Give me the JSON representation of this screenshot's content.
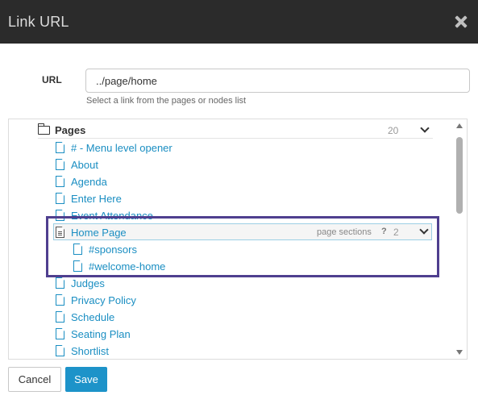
{
  "dialog": {
    "title": "Link URL"
  },
  "url_field": {
    "label": "URL",
    "value": "../page/home",
    "help": "Select a link from the pages or nodes list"
  },
  "tree": {
    "root": {
      "label": "Pages",
      "count": "20"
    },
    "items": [
      {
        "label": "# - Menu level opener"
      },
      {
        "label": "About"
      },
      {
        "label": "Agenda"
      },
      {
        "label": "Enter Here"
      },
      {
        "label": "Event Attendance"
      }
    ],
    "expanded": {
      "label": "Home Page",
      "sections_label": "page sections",
      "sections_help": "?",
      "sections_count": "2",
      "sections": [
        {
          "label": "#sponsors"
        },
        {
          "label": "#welcome-home"
        }
      ]
    },
    "items_after": [
      {
        "label": "Judges"
      },
      {
        "label": "Privacy Policy"
      },
      {
        "label": "Schedule"
      },
      {
        "label": "Seating Plan"
      },
      {
        "label": "Shortlist"
      }
    ]
  },
  "buttons": {
    "cancel": "Cancel",
    "save": "Save"
  },
  "colors": {
    "titlebar": "#2b2b2b",
    "link": "#1a8ec2",
    "highlight": "#4f3f8f",
    "save_button": "#1d93c9"
  }
}
